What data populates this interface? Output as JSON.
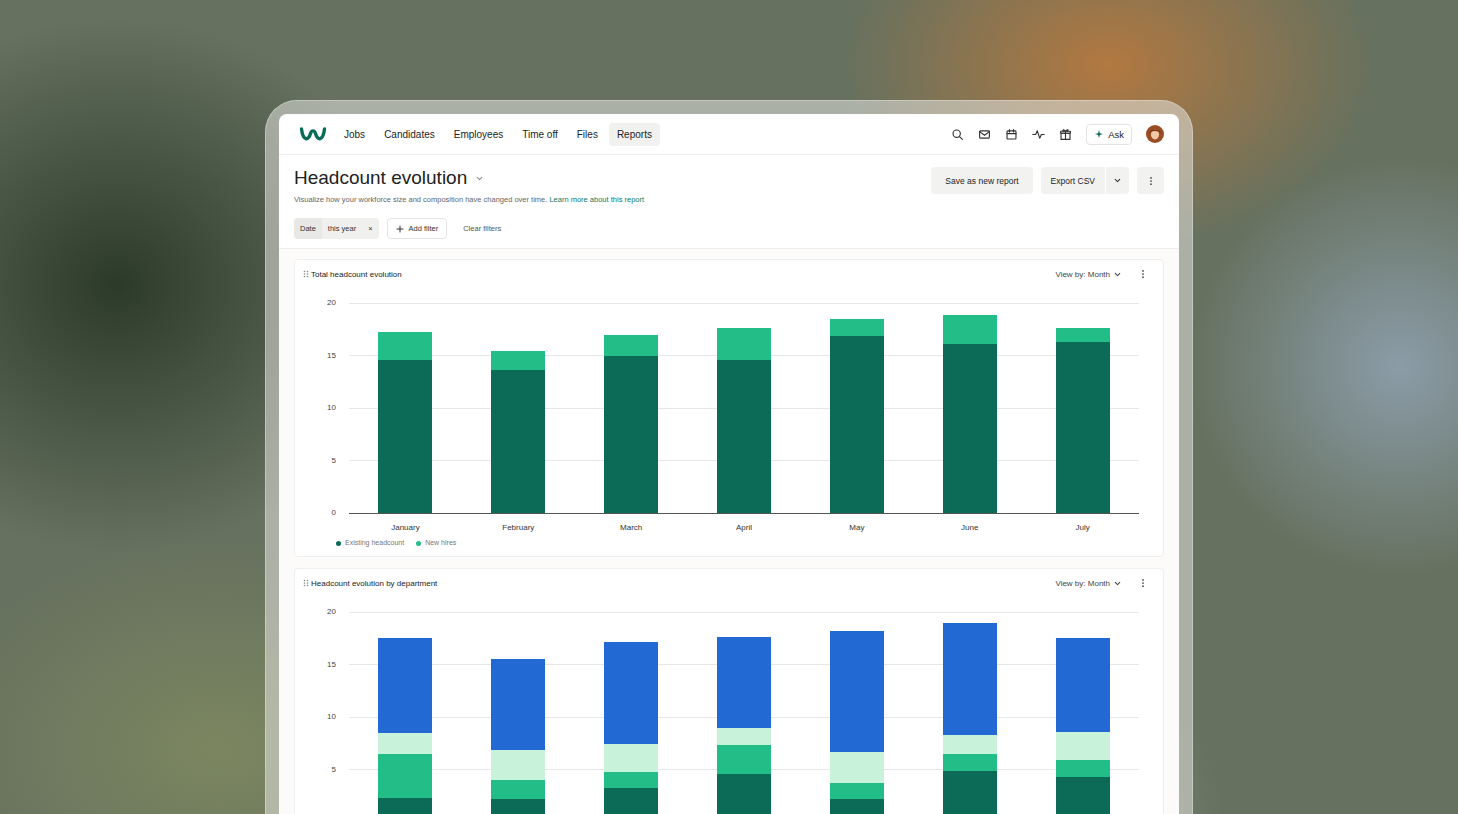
{
  "app": {
    "nav": [
      {
        "label": "Jobs",
        "selected": false
      },
      {
        "label": "Candidates",
        "selected": false
      },
      {
        "label": "Employees",
        "selected": false
      },
      {
        "label": "Time off",
        "selected": false
      },
      {
        "label": "Files",
        "selected": false
      },
      {
        "label": "Reports",
        "selected": true
      }
    ],
    "ask_button": "Ask"
  },
  "page": {
    "title": "Headcount evolution",
    "subtitle": "Visualize how your workforce size and composition have changed over time.",
    "learn_more": "Learn more about this report",
    "buttons": {
      "save": "Save as new report",
      "export": "Export CSV"
    }
  },
  "filters": {
    "chips": [
      {
        "field": "Date",
        "value": "this year",
        "remove": "×"
      }
    ],
    "add_filter": "Add filter",
    "clear": "Clear filters"
  },
  "charts": [
    {
      "title": "Total headcount evolution",
      "view_by": "View by: Month",
      "y_ticks": [
        "0",
        "5",
        "10",
        "15",
        "20"
      ],
      "categories": [
        "January",
        "February",
        "March",
        "April",
        "May",
        "June",
        "July"
      ],
      "series": [
        {
          "name": "Existing headcount",
          "color": "#0b6b57",
          "values": [
            14.6,
            13.6,
            15.0,
            14.6,
            16.9,
            16.1,
            16.3
          ]
        },
        {
          "name": "New hires",
          "color": "#23bd88",
          "values": [
            2.6,
            1.8,
            2.0,
            3.0,
            1.6,
            2.8,
            1.3
          ]
        }
      ]
    },
    {
      "title": "Headcount evolution by department",
      "view_by": "View by: Month",
      "y_ticks": [
        "5",
        "10",
        "15",
        "20"
      ],
      "series": [
        {
          "color": "#0b6b57",
          "values": [
            2.3,
            2.2,
            3.2,
            4.6,
            2.2,
            4.9,
            4.3
          ]
        },
        {
          "color": "#23bd88",
          "values": [
            4.2,
            1.8,
            1.6,
            2.7,
            1.5,
            1.6,
            1.6
          ]
        },
        {
          "color": "#c8f2da",
          "values": [
            2.0,
            2.9,
            2.6,
            1.7,
            3.0,
            1.8,
            2.7
          ]
        },
        {
          "color": "#2369d3",
          "values": [
            9.0,
            8.6,
            9.7,
            8.6,
            11.5,
            10.7,
            8.9
          ]
        }
      ]
    }
  ]
}
